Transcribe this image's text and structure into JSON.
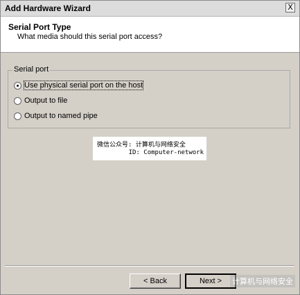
{
  "window": {
    "title": "Add Hardware Wizard",
    "close_glyph": "X"
  },
  "header": {
    "title": "Serial Port Type",
    "subtitle": "What media should this serial port access?"
  },
  "serial_port": {
    "legend": "Serial port",
    "options": [
      {
        "label": "Use physical serial port on the host",
        "checked": true
      },
      {
        "label": "Output to file",
        "checked": false
      },
      {
        "label": "Output to named pipe",
        "checked": false
      }
    ]
  },
  "watermark": {
    "line1": "微信公众号: 计算机与网络安全",
    "line2": "ID: Computer-network",
    "corner": "计算机与网络安全"
  },
  "buttons": {
    "back": "< Back",
    "next": "Next >"
  }
}
